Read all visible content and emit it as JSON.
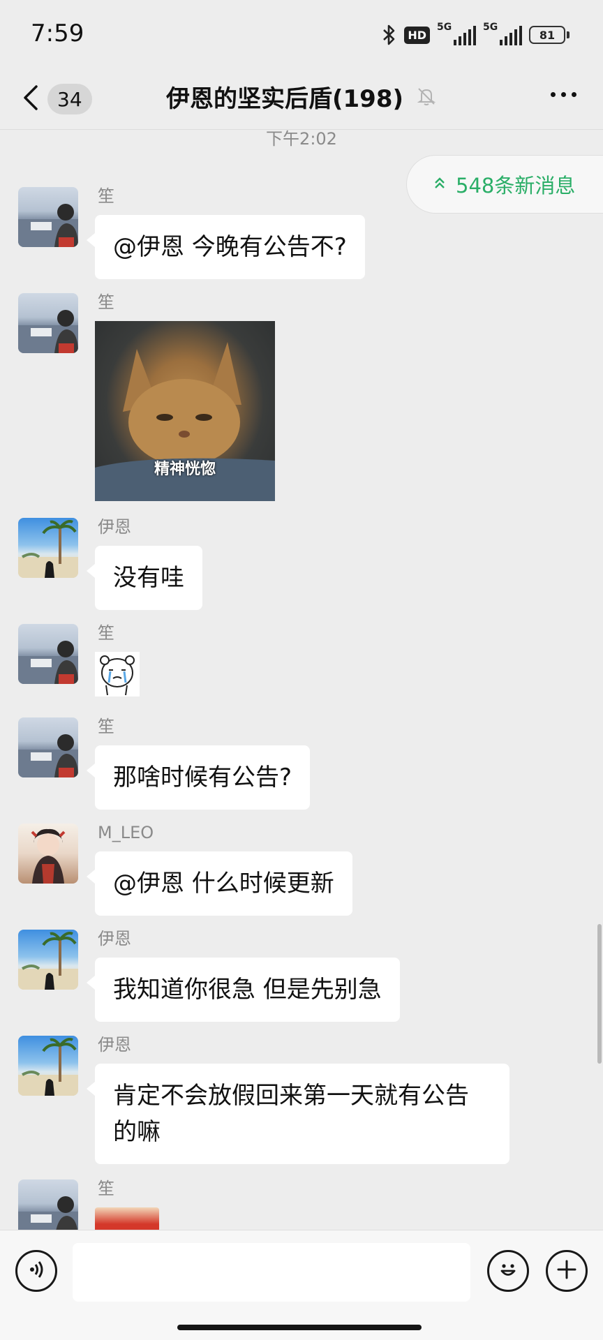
{
  "status_bar": {
    "time": "7:59",
    "hd_badge": "HD",
    "network_1": "5G",
    "network_2": "5G",
    "battery": "81"
  },
  "nav": {
    "unread_count": "34",
    "title": "伊恩的坚实后盾(198)",
    "icons": [
      "back-arrow-icon",
      "mute-bell-icon",
      "more-icon"
    ]
  },
  "chat": {
    "time_separator": "下午2:02",
    "new_messages": "548条新消息",
    "messages": [
      {
        "sender": "笙",
        "type": "text",
        "text": "@伊恩  今晚有公告不?"
      },
      {
        "sender": "笙",
        "type": "sticker",
        "caption": "精神恍惚"
      },
      {
        "sender": "伊恩",
        "type": "text",
        "text": "没有哇"
      },
      {
        "sender": "笙",
        "type": "sticker"
      },
      {
        "sender": "笙",
        "type": "text",
        "text": "那啥时候有公告?"
      },
      {
        "sender": "M_LEO",
        "type": "text",
        "text": "@伊恩  什么时候更新"
      },
      {
        "sender": "伊恩",
        "type": "text",
        "text": "我知道你很急 但是先别急"
      },
      {
        "sender": "伊恩",
        "type": "text",
        "text": "肯定不会放假回来第一天就有公告的嘛"
      },
      {
        "sender": "笙",
        "type": "sticker"
      }
    ]
  },
  "input_bar": {
    "placeholder": "",
    "icons": [
      "voice-icon",
      "emoji-icon",
      "plus-icon"
    ]
  },
  "colors": {
    "background": "#ededed",
    "accent_green": "#2aae67",
    "bubble": "#ffffff"
  }
}
